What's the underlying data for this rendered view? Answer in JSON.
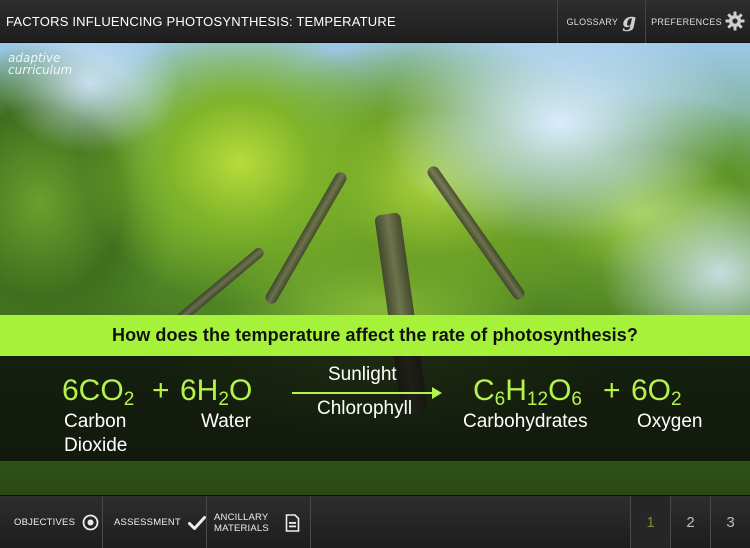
{
  "header": {
    "title": "FACTORS INFLUENCING PHOTOSYNTHESIS: TEMPERATURE",
    "glossary_label": "GLOSSARY",
    "glossary_icon": "g",
    "preferences_label": "PREFERENCES"
  },
  "logo": {
    "line1": "adaptive",
    "line2": "curriculum"
  },
  "slide": {
    "question": "How does the temperature affect the rate of photosynthesis?",
    "reactant1_coef": "6CO",
    "reactant1_sub": "2",
    "plus1": "+",
    "reactant2_coef": "6H",
    "reactant2_sub": "2",
    "reactant2_tail": "O",
    "condition_top": "Sunlight",
    "condition_bottom": "Chlorophyll",
    "product1_c": "C",
    "product1_c_sub": "6",
    "product1_h": "H",
    "product1_h_sub": "12",
    "product1_o": "O",
    "product1_o_sub": "6",
    "plus2": "+",
    "product2_coef": "6O",
    "product2_sub": "2",
    "label_carbon": "Carbon",
    "label_dioxide": "Dioxide",
    "label_water": "Water",
    "label_carbohydrates": "Carbohydrates",
    "label_oxygen": "Oxygen"
  },
  "footer": {
    "objectives_label": "OBJECTIVES",
    "assessment_label": "ASSESSMENT",
    "ancillary_label": "ANCILLARY MATERIALS",
    "pages": [
      "1",
      "2",
      "3"
    ],
    "active_page": 1
  },
  "colors": {
    "accent_green": "#a6f23b",
    "equation_green": "#b4f34a"
  }
}
